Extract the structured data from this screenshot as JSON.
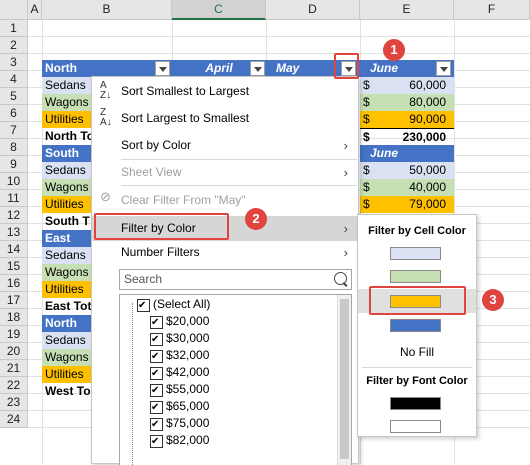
{
  "columns": [
    "A",
    "B",
    "C",
    "D",
    "E",
    "F"
  ],
  "rows": [
    "1",
    "2",
    "3",
    "4",
    "5",
    "6",
    "7",
    "8",
    "9",
    "10",
    "11",
    "12",
    "13",
    "14",
    "15",
    "16",
    "17",
    "18",
    "19",
    "20",
    "21",
    "22",
    "23",
    "24"
  ],
  "table": {
    "north": "North",
    "april": "April",
    "may": "May",
    "june": "June",
    "sedans": "Sedans",
    "wagons": "Wagons",
    "utilities": "Utilities",
    "north_total": "North To",
    "south": "South",
    "south_total": "South T",
    "east": "East",
    "east_total": "East Tot",
    "west_total": "West To",
    "dollar": "$",
    "e4": "60,000",
    "e5": "80,000",
    "e6": "90,000",
    "e7": "230,000",
    "e9": "50,000",
    "e10": "40,000",
    "e11": "79,000"
  },
  "menu": {
    "sort_asc": "Sort Smallest to Largest",
    "sort_desc": "Sort Largest to Smallest",
    "sort_color": "Sort by Color",
    "sheet_view": "Sheet View",
    "clear_filter": "Clear Filter From \"May\"",
    "filter_color": "Filter by Color",
    "number_filters": "Number Filters",
    "search_placeholder": "Search",
    "list": [
      "(Select All)",
      "$20,000",
      "$30,000",
      "$32,000",
      "$42,000",
      "$55,000",
      "$65,000",
      "$75,000",
      "$82,000"
    ]
  },
  "submenu": {
    "cell_color_title": "Filter by Cell Color",
    "no_fill": "No Fill",
    "font_color_title": "Filter by Font Color",
    "cell_colors": [
      "#d9e1f2",
      "#c6e0b4",
      "#ffc000",
      "#4472c4"
    ],
    "font_colors": [
      "#000000",
      "#ffffff"
    ]
  },
  "annotations": {
    "step1": "1",
    "step2": "2",
    "step3": "3"
  },
  "colors": {
    "header_blue": "#4472c4",
    "accent_red": "#e0443e",
    "excel_green": "#217346"
  }
}
